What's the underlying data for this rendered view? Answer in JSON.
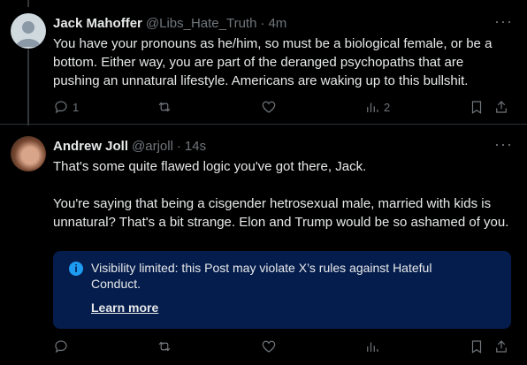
{
  "posts": [
    {
      "name": "Jack Mahoffer",
      "handle": "@Libs_Hate_Truth",
      "time": "4m",
      "text": "You have your pronouns as he/him, so must be a biological female, or be a bottom. Either way, you are part of the deranged psychopaths that are pushing an unnatural lifestyle. Americans are waking up to this bullshit.",
      "replies": "1",
      "reposts": "",
      "likes": "",
      "views": "2"
    },
    {
      "name": "Andrew Joll",
      "handle": "@arjoll",
      "time": "14s",
      "text": "That's some quite flawed logic you've got there, Jack.\n\nYou're saying that being a cisgender hetrosexual male, married with kids is unnatural? That's a bit strange. Elon and Trump would be so ashamed of you.",
      "notice": {
        "text": "Visibility limited: this Post may violate X’s rules against Hateful Conduct.",
        "link": "Learn more"
      }
    }
  ],
  "ui": {
    "more_glyph": "···",
    "dot": "·",
    "info_glyph": "i"
  }
}
